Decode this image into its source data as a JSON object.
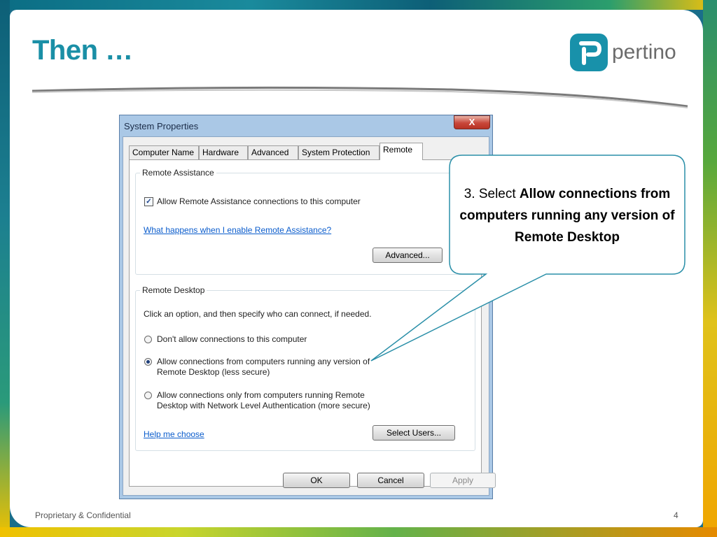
{
  "slide": {
    "title": "Then …",
    "footer": "Proprietary & Confidential",
    "page_number": "4"
  },
  "logo": {
    "text": "pertino",
    "icon": "pertino-logo-icon"
  },
  "dialog": {
    "title": "System Properties",
    "close_label": "X",
    "tabs": [
      {
        "label": "Computer Name"
      },
      {
        "label": "Hardware"
      },
      {
        "label": "Advanced"
      },
      {
        "label": "System Protection"
      },
      {
        "label": "Remote",
        "active": true
      }
    ],
    "remote_assistance": {
      "group_label": "Remote Assistance",
      "checkbox_label": "Allow Remote Assistance connections to this computer",
      "checked": true,
      "help_link": "What happens when I enable Remote Assistance?",
      "advanced_button": "Advanced..."
    },
    "remote_desktop": {
      "group_label": "Remote Desktop",
      "instruction": "Click an option, and then specify who can connect, if needed.",
      "options": [
        {
          "line1": "Don't allow connections to this computer",
          "line2": "",
          "selected": false
        },
        {
          "line1": "Allow connections from computers running any version of",
          "line2": "Remote Desktop (less secure)",
          "selected": true
        },
        {
          "line1": "Allow connections only from computers running Remote",
          "line2": "Desktop with Network Level Authentication (more secure)",
          "selected": false
        }
      ],
      "help_link": "Help me choose",
      "select_users_button": "Select Users..."
    },
    "buttons": {
      "ok": "OK",
      "cancel": "Cancel",
      "apply": "Apply"
    }
  },
  "callout": {
    "prefix": "3. Select ",
    "bold": "Allow connections from computers running any version of Remote Desktop"
  },
  "colors": {
    "title": "#1a8fa6",
    "logo": "#1891aa",
    "callout_border": "#2a8fa8"
  }
}
